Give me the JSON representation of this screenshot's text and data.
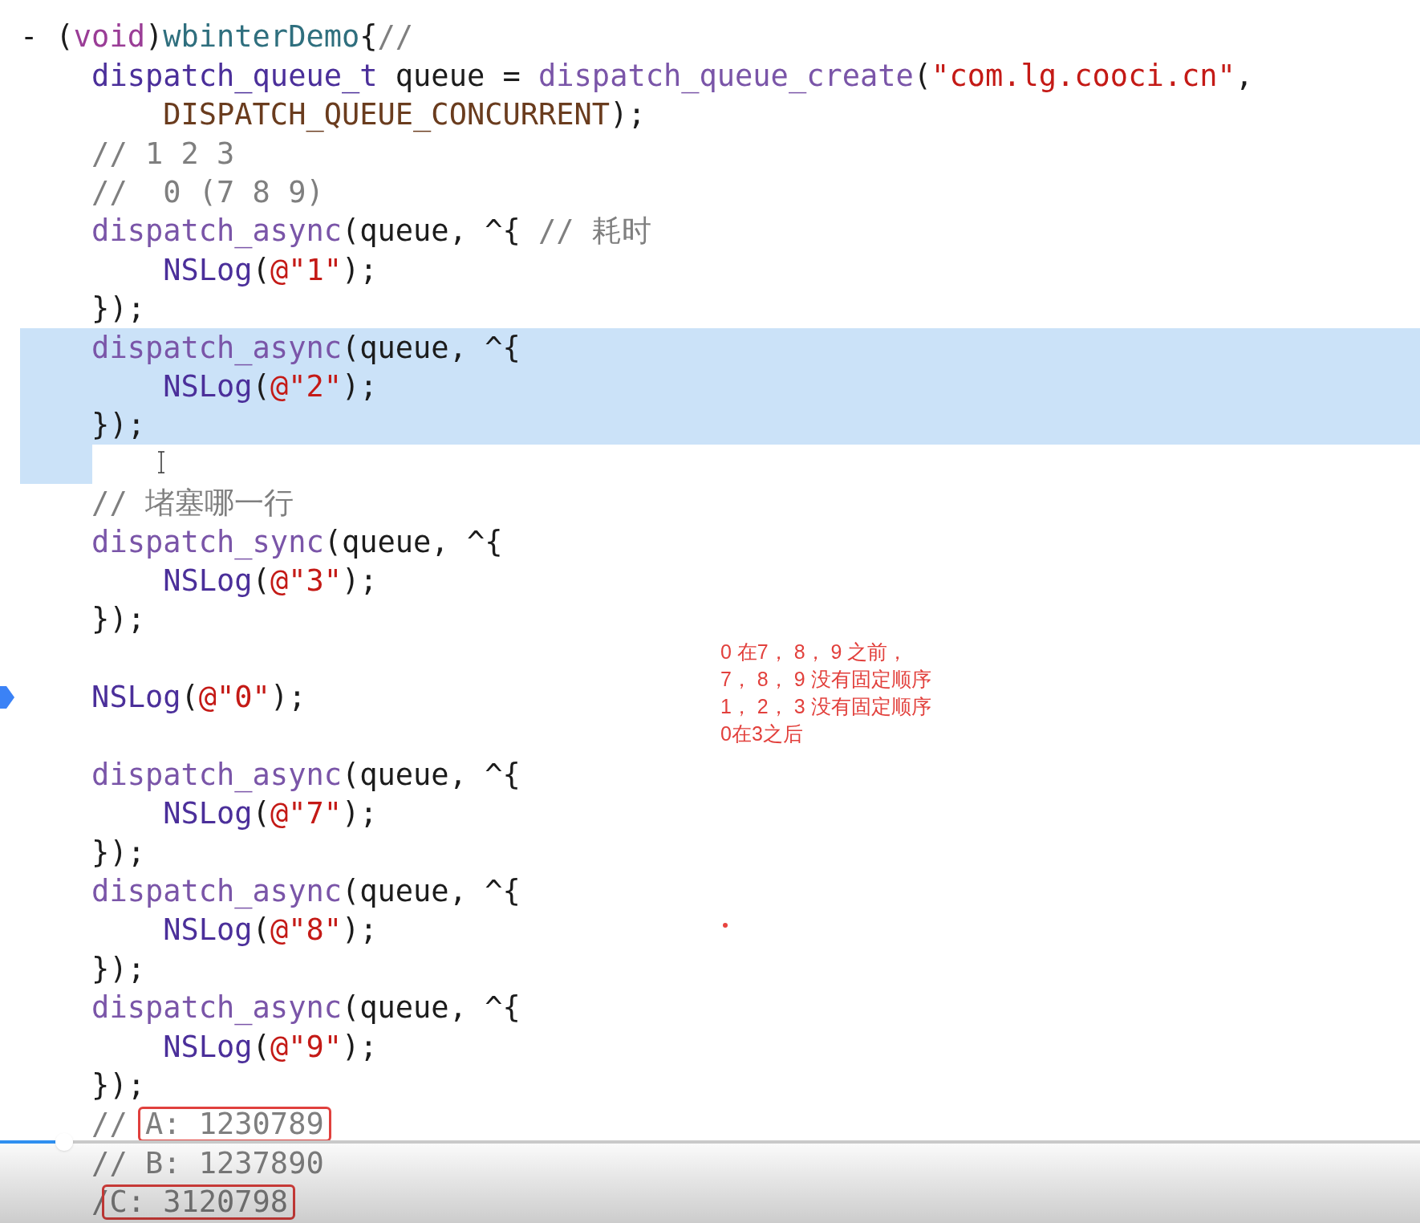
{
  "editor": {
    "lines": [
      {
        "tokens": [
          {
            "kind": "plain",
            "text": "- ("
          },
          {
            "kind": "keyword",
            "text": "void"
          },
          {
            "kind": "plain",
            "text": ")"
          },
          {
            "kind": "decl",
            "text": "wbinterDemo"
          },
          {
            "kind": "plain",
            "text": "{"
          },
          {
            "kind": "comment",
            "text": "//"
          }
        ]
      },
      {
        "tokens": [
          {
            "kind": "type",
            "text": "    dispatch_queue_t"
          },
          {
            "kind": "plain",
            "text": " queue = "
          },
          {
            "kind": "func",
            "text": "dispatch_queue_create"
          },
          {
            "kind": "plain",
            "text": "("
          },
          {
            "kind": "string",
            "text": "\"com.lg.cooci.cn\""
          },
          {
            "kind": "plain",
            "text": ","
          }
        ]
      },
      {
        "tokens": [
          {
            "kind": "macro",
            "text": "        DISPATCH_QUEUE_CONCURRENT"
          },
          {
            "kind": "plain",
            "text": ");"
          }
        ]
      },
      {
        "tokens": [
          {
            "kind": "comment",
            "text": "    // 1 2 3"
          }
        ]
      },
      {
        "tokens": [
          {
            "kind": "comment",
            "text": "    //  0 (7 8 9)"
          }
        ]
      },
      {
        "tokens": [
          {
            "kind": "func",
            "text": "    dispatch_async"
          },
          {
            "kind": "plain",
            "text": "(queue, ^{ "
          },
          {
            "kind": "comment",
            "text": "// 耗时"
          }
        ]
      },
      {
        "tokens": [
          {
            "kind": "type",
            "text": "        NSLog"
          },
          {
            "kind": "plain",
            "text": "("
          },
          {
            "kind": "string",
            "text": "@\"1\""
          },
          {
            "kind": "plain",
            "text": ");"
          }
        ]
      },
      {
        "tokens": [
          {
            "kind": "plain",
            "text": "    });"
          }
        ]
      },
      {
        "highlighted": true,
        "tokens": [
          {
            "kind": "func",
            "text": "    dispatch_async"
          },
          {
            "kind": "plain",
            "text": "(queue, ^{"
          }
        ]
      },
      {
        "highlighted": true,
        "tokens": [
          {
            "kind": "type",
            "text": "        NSLog"
          },
          {
            "kind": "plain",
            "text": "("
          },
          {
            "kind": "string",
            "text": "@\"2\""
          },
          {
            "kind": "plain",
            "text": ");"
          }
        ]
      },
      {
        "highlighted": true,
        "tokens": [
          {
            "kind": "plain",
            "text": "    });"
          }
        ]
      },
      {
        "kind": "blank",
        "highlighted": true
      },
      {
        "tokens": [
          {
            "kind": "comment",
            "text": "    // 堵塞哪一行"
          }
        ]
      },
      {
        "tokens": [
          {
            "kind": "func",
            "text": "    dispatch_sync"
          },
          {
            "kind": "plain",
            "text": "(queue, ^{"
          }
        ]
      },
      {
        "tokens": [
          {
            "kind": "type",
            "text": "        NSLog"
          },
          {
            "kind": "plain",
            "text": "("
          },
          {
            "kind": "string",
            "text": "@\"3\""
          },
          {
            "kind": "plain",
            "text": ");"
          }
        ]
      },
      {
        "tokens": [
          {
            "kind": "plain",
            "text": "    });"
          }
        ]
      },
      {
        "kind": "blank"
      },
      {
        "current": true,
        "tokens": [
          {
            "kind": "type",
            "text": "    NSLog"
          },
          {
            "kind": "plain",
            "text": "("
          },
          {
            "kind": "string",
            "text": "@\"0\""
          },
          {
            "kind": "plain",
            "text": ");"
          }
        ]
      },
      {
        "kind": "blank"
      },
      {
        "tokens": [
          {
            "kind": "func",
            "text": "    dispatch_async"
          },
          {
            "kind": "plain",
            "text": "(queue, ^{"
          }
        ]
      },
      {
        "tokens": [
          {
            "kind": "type",
            "text": "        NSLog"
          },
          {
            "kind": "plain",
            "text": "("
          },
          {
            "kind": "string",
            "text": "@\"7\""
          },
          {
            "kind": "plain",
            "text": ");"
          }
        ]
      },
      {
        "tokens": [
          {
            "kind": "plain",
            "text": "    });"
          }
        ]
      },
      {
        "tokens": [
          {
            "kind": "func",
            "text": "    dispatch_async"
          },
          {
            "kind": "plain",
            "text": "(queue, ^{"
          }
        ]
      },
      {
        "tokens": [
          {
            "kind": "type",
            "text": "        NSLog"
          },
          {
            "kind": "plain",
            "text": "("
          },
          {
            "kind": "string",
            "text": "@\"8\""
          },
          {
            "kind": "plain",
            "text": ");"
          }
        ]
      },
      {
        "tokens": [
          {
            "kind": "plain",
            "text": "    });"
          }
        ]
      },
      {
        "tokens": [
          {
            "kind": "func",
            "text": "    dispatch_async"
          },
          {
            "kind": "plain",
            "text": "(queue, ^{"
          }
        ]
      },
      {
        "tokens": [
          {
            "kind": "type",
            "text": "        NSLog"
          },
          {
            "kind": "plain",
            "text": "("
          },
          {
            "kind": "string",
            "text": "@\"9\""
          },
          {
            "kind": "plain",
            "text": ");"
          }
        ]
      },
      {
        "tokens": [
          {
            "kind": "plain",
            "text": "    });"
          }
        ]
      },
      {
        "tokens": [
          {
            "kind": "comment",
            "text": "    // "
          },
          {
            "kind": "comment",
            "text": "A: 1230789",
            "boxed": true
          }
        ]
      },
      {
        "tokens": [
          {
            "kind": "comment",
            "text": "    // B: 1237890"
          }
        ]
      },
      {
        "tokens": [
          {
            "kind": "comment",
            "text": "    /"
          },
          {
            "kind": "comment",
            "text": "C: 3120798",
            "boxed": true
          }
        ]
      }
    ]
  },
  "annotation": [
    "0 在7， 8， 9 之前，",
    "7， 8， 9 没有固定顺序",
    "1， 2， 3 没有固定顺序",
    "0在3之后"
  ],
  "video_player": {
    "progress": {
      "level": 0.045
    }
  }
}
